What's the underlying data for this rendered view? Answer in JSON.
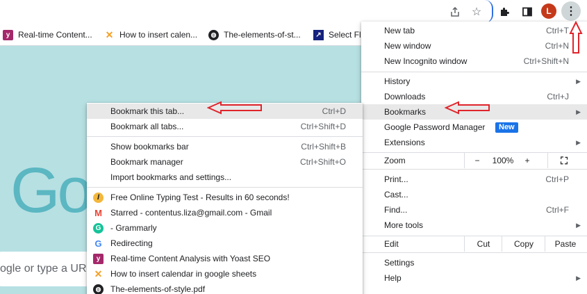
{
  "toolbar": {
    "avatar_letter": "L",
    "icons": [
      "share-icon",
      "star-icon",
      "puzzle-icon",
      "side-panel-icon",
      "more-vert-icon"
    ]
  },
  "bookmarks_bar": [
    {
      "label": "Real-time Content...",
      "icon": "yoast-icon"
    },
    {
      "label": "How to insert calen...",
      "icon": "calendar-icon"
    },
    {
      "label": "The-elements-of-st...",
      "icon": "globe-icon"
    },
    {
      "label": "Select Fl",
      "icon": "select-icon"
    }
  ],
  "page": {
    "logo_text": "Go",
    "search_placeholder": "ogle or type a URL"
  },
  "main_menu": {
    "new_tab": {
      "label": "New tab",
      "shortcut": "Ctrl+T"
    },
    "new_window": {
      "label": "New window",
      "shortcut": "Ctrl+N"
    },
    "new_incognito": {
      "label": "New Incognito window",
      "shortcut": "Ctrl+Shift+N"
    },
    "history": {
      "label": "History"
    },
    "downloads": {
      "label": "Downloads",
      "shortcut": "Ctrl+J"
    },
    "bookmarks": {
      "label": "Bookmarks"
    },
    "password_manager": {
      "label": "Google Password Manager",
      "badge": "New"
    },
    "extensions": {
      "label": "Extensions"
    },
    "zoom": {
      "label": "Zoom",
      "minus": "−",
      "value": "100%",
      "plus": "+"
    },
    "print": {
      "label": "Print...",
      "shortcut": "Ctrl+P"
    },
    "cast": {
      "label": "Cast..."
    },
    "find": {
      "label": "Find...",
      "shortcut": "Ctrl+F"
    },
    "more_tools": {
      "label": "More tools"
    },
    "edit": {
      "label": "Edit",
      "cut": "Cut",
      "copy": "Copy",
      "paste": "Paste"
    },
    "settings": {
      "label": "Settings"
    },
    "help": {
      "label": "Help"
    }
  },
  "bookmarks_submenu": {
    "bookmark_tab": {
      "label": "Bookmark this tab...",
      "shortcut": "Ctrl+D"
    },
    "bookmark_all": {
      "label": "Bookmark all tabs...",
      "shortcut": "Ctrl+Shift+D"
    },
    "show_bar": {
      "label": "Show bookmarks bar",
      "shortcut": "Ctrl+Shift+B"
    },
    "manager": {
      "label": "Bookmark manager",
      "shortcut": "Ctrl+Shift+O"
    },
    "import": {
      "label": "Import bookmarks and settings..."
    },
    "items": [
      {
        "label": "Free Online Typing Test - Results in 60 seconds!",
        "icon": "typing-icon"
      },
      {
        "label": "Starred - contentus.liza@gmail.com - Gmail",
        "icon": "gmail-icon"
      },
      {
        "label": "- Grammarly",
        "icon": "grammarly-icon"
      },
      {
        "label": "Redirecting",
        "icon": "google-icon"
      },
      {
        "label": "Real-time Content Analysis with Yoast SEO",
        "icon": "yoast-icon"
      },
      {
        "label": "How to insert calendar in google sheets",
        "icon": "calendar-icon"
      },
      {
        "label": "The-elements-of-style.pdf",
        "icon": "globe-icon"
      }
    ]
  },
  "colors": {
    "page_background": "#b7e0e3",
    "annotation_arrow": "#e0242b",
    "highlight": "#e8e8e8",
    "new_badge": "#1a73e8"
  }
}
